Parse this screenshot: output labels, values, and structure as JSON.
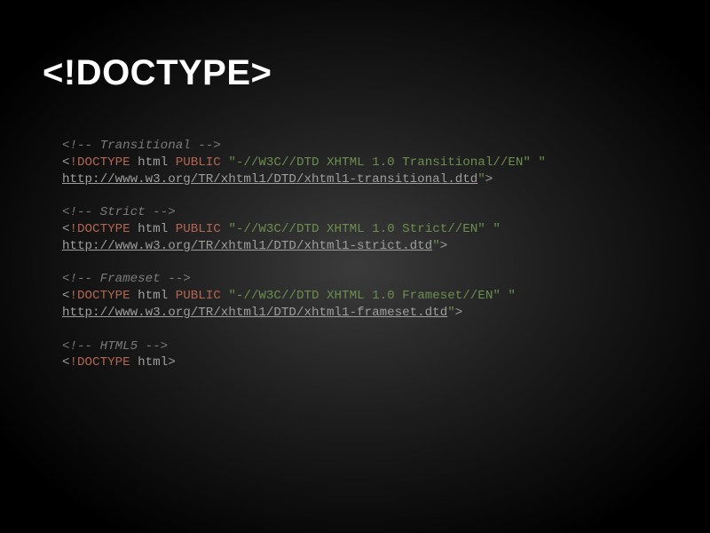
{
  "title": "<!DOCTYPE>",
  "blocks": {
    "transitional": {
      "comment": "<!-- Transitional -->",
      "fpi": "\"-//W3C//DTD XHTML 1.0 Transitional//EN\"",
      "url": "http://www.w3.org/TR/xhtml1/DTD/xhtml1-transitional.dtd"
    },
    "strict": {
      "comment": "<!-- Strict -->",
      "fpi": "\"-//W3C//DTD XHTML 1.0 Strict//EN\"",
      "url": "http://www.w3.org/TR/xhtml1/DTD/xhtml1-strict.dtd"
    },
    "frameset": {
      "comment": "<!-- Frameset -->",
      "fpi": "\"-//W3C//DTD XHTML 1.0 Frameset//EN\"",
      "url": "http://www.w3.org/TR/xhtml1/DTD/xhtml1-frameset.dtd"
    },
    "html5": {
      "comment": "<!-- HTML5 -->"
    }
  },
  "tokens": {
    "open": "<",
    "bang_doctype": "!DOCTYPE",
    "html_kw": "html",
    "public_kw": "PUBLIC",
    "quote": "\"",
    "close_gt": ">",
    "space_quote": " \""
  }
}
